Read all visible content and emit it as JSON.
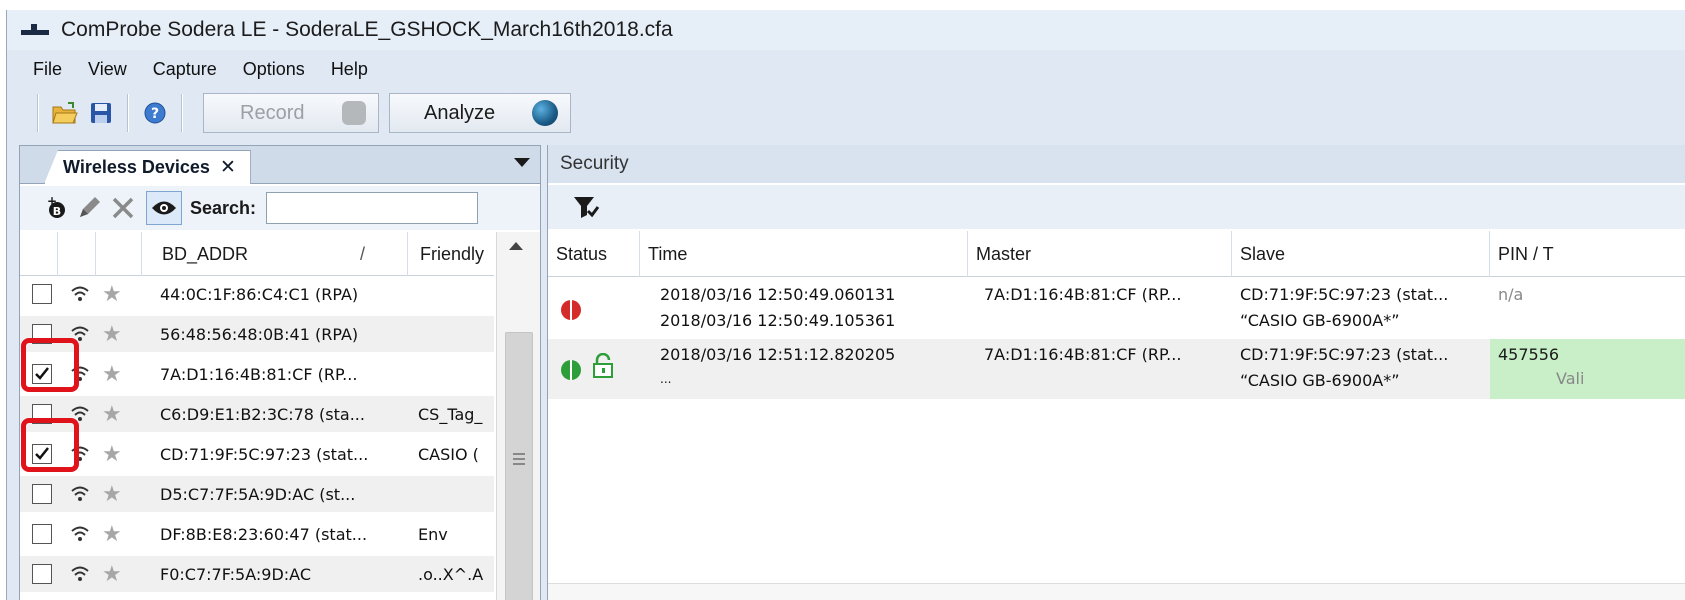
{
  "window": {
    "title": "ComProbe Sodera LE - SoderaLE_GSHOCK_March16th2018.cfa"
  },
  "menu": [
    "File",
    "View",
    "Capture",
    "Options",
    "Help"
  ],
  "toolbar": {
    "record_label": "Record",
    "analyze_label": "Analyze"
  },
  "devices_panel": {
    "tab_label": "Wireless Devices",
    "tab_close": "✕",
    "search_label": "Search:",
    "search_value": "",
    "columns": {
      "bd_addr": "BD_ADDR",
      "sort": "/",
      "friendly": "Friendly"
    },
    "rows": [
      {
        "checked": false,
        "addr": "44:0C:1F:86:C4:C1 (RPA)",
        "friendly": ""
      },
      {
        "checked": false,
        "addr": "56:48:56:48:0B:41 (RPA)",
        "friendly": ""
      },
      {
        "checked": true,
        "addr": "7A:D1:16:4B:81:CF (RP...",
        "friendly": ""
      },
      {
        "checked": false,
        "addr": "C6:D9:E1:B2:3C:78 (sta...",
        "friendly": "CS_Tag_"
      },
      {
        "checked": true,
        "addr": "CD:71:9F:5C:97:23 (stat...",
        "friendly": "CASIO ("
      },
      {
        "checked": false,
        "addr": "D5:C7:7F:5A:9D:AC (st...",
        "friendly": ""
      },
      {
        "checked": false,
        "addr": "DF:8B:E8:23:60:47 (stat...",
        "friendly": "Env"
      },
      {
        "checked": false,
        "addr": "F0:C7:7F:5A:9D:AC",
        "friendly": ".o..X^.A"
      }
    ]
  },
  "security_panel": {
    "title": "Security",
    "columns": {
      "status": "Status",
      "time": "Time",
      "master": "Master",
      "slave": "Slave",
      "pin": "PIN / T"
    },
    "rows": [
      {
        "status": "failed",
        "time": [
          "2018/03/16 12:50:49.060131",
          "2018/03/16 12:50:49.105361"
        ],
        "master": "7A:D1:16:4B:81:CF (RP...",
        "slave": [
          "CD:71:9F:5C:97:23 (stat...",
          "“CASIO GB-6900A*”"
        ],
        "pin": "n/a"
      },
      {
        "status": "success",
        "time": [
          "2018/03/16 12:51:12.820205",
          "..."
        ],
        "master": "7A:D1:16:4B:81:CF (RP...",
        "slave": [
          "CD:71:9F:5C:97:23 (stat...",
          "“CASIO GB-6900A*”"
        ],
        "pin": "457556",
        "pin_status": "Vali"
      }
    ]
  },
  "colors": {
    "highlight": "#e0131b",
    "pin_valid_bg": "#c8efc8",
    "status_red": "#d42a2a",
    "status_green": "#2e9e3a"
  }
}
